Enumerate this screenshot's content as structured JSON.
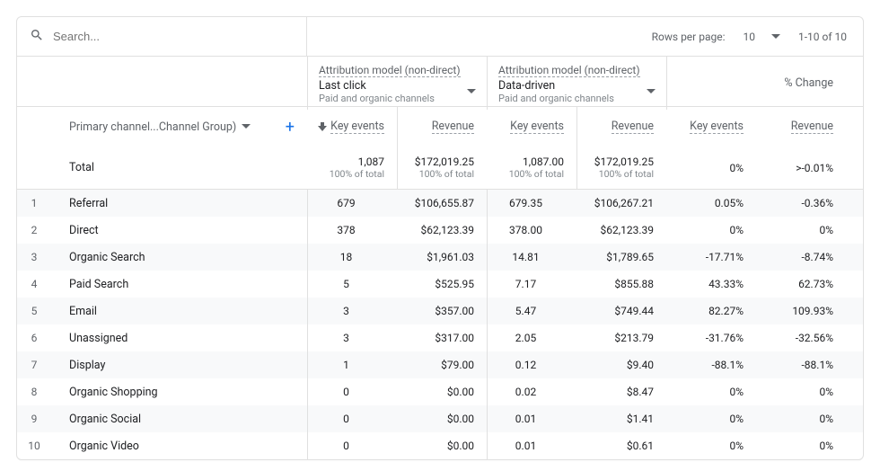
{
  "search": {
    "placeholder": "Search..."
  },
  "pager": {
    "rows_per_page_label": "Rows per page:",
    "rows_per_page_value": "10",
    "range": "1-10 of 10"
  },
  "segments": {
    "a": {
      "title": "Attribution model (non-direct)",
      "model": "Last click",
      "desc": "Paid and organic channels"
    },
    "b": {
      "title": "Attribution model (non-direct)",
      "model": "Data-driven",
      "desc": "Paid and organic channels"
    },
    "change_label": "% Change"
  },
  "dimension": {
    "label": "Primary channel...Channel Group)"
  },
  "metrics": {
    "key_events": "Key events",
    "revenue": "Revenue"
  },
  "totals": {
    "label": "Total",
    "a_key": "1,087",
    "a_rev": "$172,019.25",
    "b_key": "1,087.00",
    "b_rev": "$172,019.25",
    "pct": "100% of total",
    "c_key": "0%",
    "c_rev": ">-0.01%"
  },
  "rows": [
    {
      "idx": "1",
      "name": "Referral",
      "a_key": "679",
      "a_rev": "$106,655.87",
      "b_key": "679.35",
      "b_rev": "$106,267.21",
      "c_key": "0.05%",
      "c_rev": "-0.36%"
    },
    {
      "idx": "2",
      "name": "Direct",
      "a_key": "378",
      "a_rev": "$62,123.39",
      "b_key": "378.00",
      "b_rev": "$62,123.39",
      "c_key": "0%",
      "c_rev": "0%"
    },
    {
      "idx": "3",
      "name": "Organic Search",
      "a_key": "18",
      "a_rev": "$1,961.03",
      "b_key": "14.81",
      "b_rev": "$1,789.65",
      "c_key": "-17.71%",
      "c_rev": "-8.74%"
    },
    {
      "idx": "4",
      "name": "Paid Search",
      "a_key": "5",
      "a_rev": "$525.95",
      "b_key": "7.17",
      "b_rev": "$855.88",
      "c_key": "43.33%",
      "c_rev": "62.73%"
    },
    {
      "idx": "5",
      "name": "Email",
      "a_key": "3",
      "a_rev": "$357.00",
      "b_key": "5.47",
      "b_rev": "$749.44",
      "c_key": "82.27%",
      "c_rev": "109.93%"
    },
    {
      "idx": "6",
      "name": "Unassigned",
      "a_key": "3",
      "a_rev": "$317.00",
      "b_key": "2.05",
      "b_rev": "$213.79",
      "c_key": "-31.76%",
      "c_rev": "-32.56%"
    },
    {
      "idx": "7",
      "name": "Display",
      "a_key": "1",
      "a_rev": "$79.00",
      "b_key": "0.12",
      "b_rev": "$9.40",
      "c_key": "-88.1%",
      "c_rev": "-88.1%"
    },
    {
      "idx": "8",
      "name": "Organic Shopping",
      "a_key": "0",
      "a_rev": "$0.00",
      "b_key": "0.02",
      "b_rev": "$8.47",
      "c_key": "0%",
      "c_rev": "0%"
    },
    {
      "idx": "9",
      "name": "Organic Social",
      "a_key": "0",
      "a_rev": "$0.00",
      "b_key": "0.01",
      "b_rev": "$1.41",
      "c_key": "0%",
      "c_rev": "0%"
    },
    {
      "idx": "10",
      "name": "Organic Video",
      "a_key": "0",
      "a_rev": "$0.00",
      "b_key": "0.01",
      "b_rev": "$0.61",
      "c_key": "0%",
      "c_rev": "0%"
    }
  ]
}
